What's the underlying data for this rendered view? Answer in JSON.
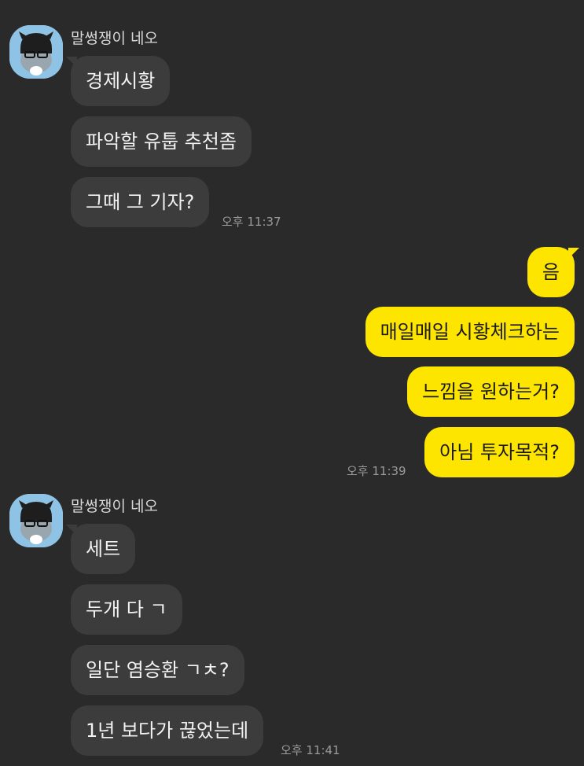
{
  "colors": {
    "background": "#2a2a2a",
    "incoming_bubble": "#3c3c3c",
    "outgoing_bubble": "#fee500",
    "timestamp": "#9a9a9a"
  },
  "group1": {
    "sender": "말썽쟁이 네오",
    "messages": [
      "경제시황",
      "파악할 유툽 추천좀",
      "그때 그 기자?"
    ],
    "time": "오후 11:37"
  },
  "group2": {
    "messages": [
      "음",
      "매일매일 시황체크하는",
      "느낌을 원하는거?",
      "아님 투자목적?"
    ],
    "time": "오후 11:39"
  },
  "group3": {
    "sender": "말썽쟁이 네오",
    "messages": [
      "세트",
      "두개 다 ㄱ",
      "일단 염승환 ㄱㅊ?",
      "1년 보다가 끊었는데"
    ],
    "time": "오후 11:41"
  }
}
